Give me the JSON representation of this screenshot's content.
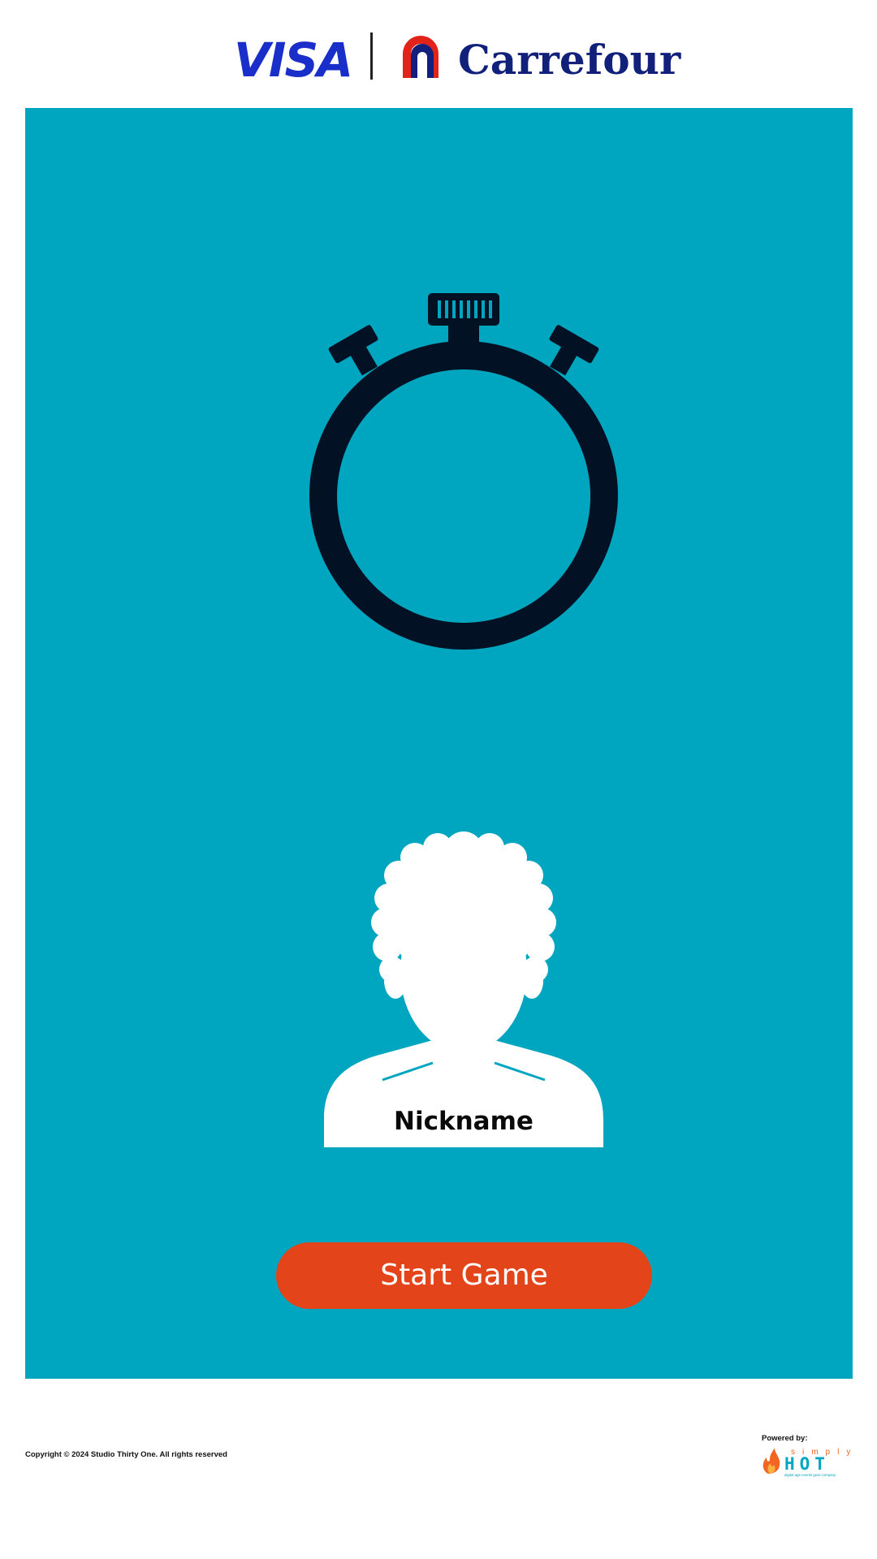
{
  "header": {
    "visa_logo_text": "VISA",
    "carrefour_logo_text": "Carrefour"
  },
  "game": {
    "timer_icon": "stopwatch-icon",
    "avatar_icon": "user-silhouette-icon",
    "nickname_label": "Nickname",
    "start_button_label": "Start Game"
  },
  "footer": {
    "copyright": "Copyright © 2024 Studio Thirty One. All rights reserved",
    "powered_by": "Powered by:",
    "powered_logo_top": "simply",
    "powered_logo_main": "HOT",
    "powered_logo_tagline": "digital age events gear company"
  },
  "colors": {
    "panel": "#00a5bf",
    "button": "#e3441a",
    "stopwatch": "#031125",
    "visa_blue": "#1a2fc9",
    "carrefour_blue": "#11207a",
    "carrefour_red": "#e2231a"
  }
}
